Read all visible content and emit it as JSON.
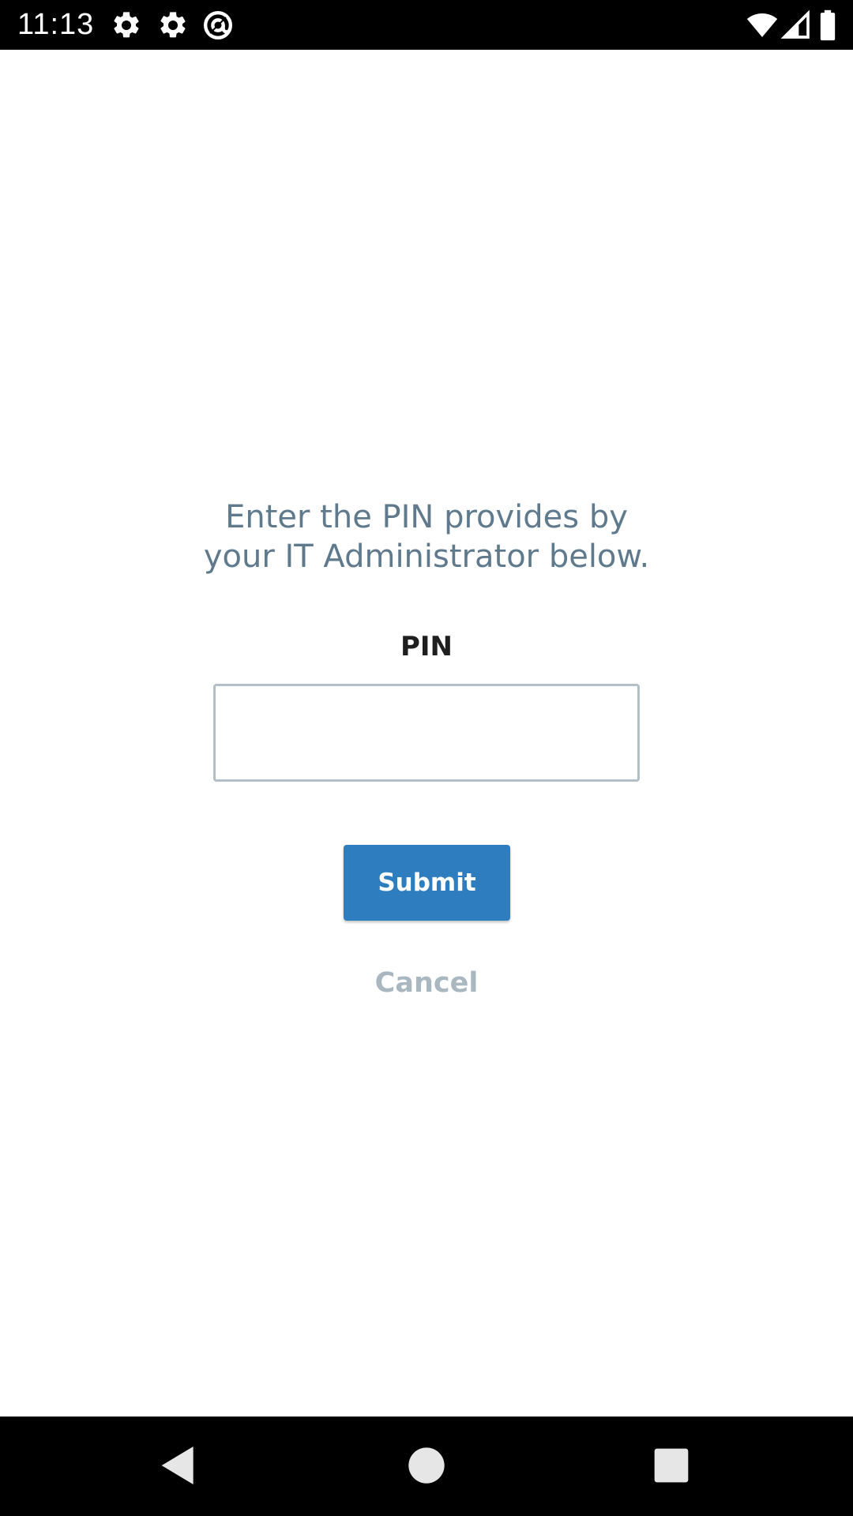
{
  "status_bar": {
    "time": "11:13",
    "icons": [
      "settings-icon",
      "settings-icon",
      "at-sign-icon",
      "wifi-icon",
      "signal-icon",
      "battery-icon"
    ]
  },
  "content": {
    "instructions": "Enter the PIN provides by\nyour IT Administrator below.",
    "pin_label": "PIN",
    "pin_value": "",
    "submit_label": "Submit",
    "cancel_label": "Cancel"
  },
  "nav_bar": {
    "icons": [
      "back-icon",
      "home-icon",
      "recents-icon"
    ]
  },
  "colors": {
    "accent": "#2e7ebf",
    "instruction_text": "#5f7a8c",
    "cancel_text": "#a9b7c1",
    "input_border": "#b3bfc6"
  }
}
